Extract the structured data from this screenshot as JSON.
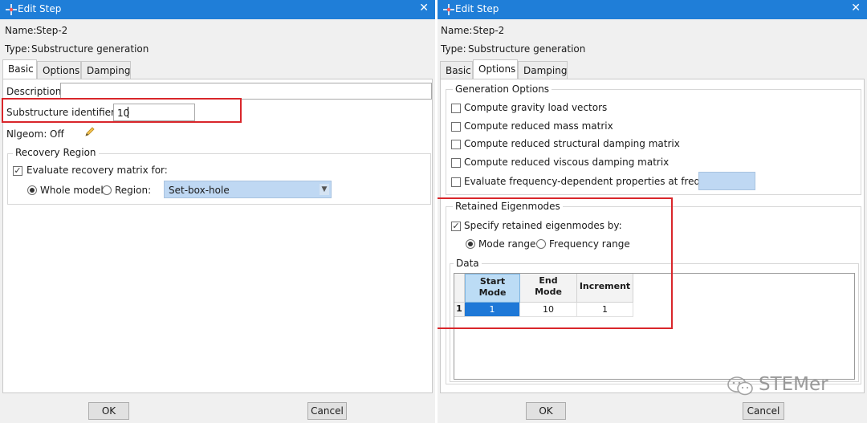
{
  "left": {
    "title": "Edit Step",
    "name_label": "Name:",
    "name_value": "Step-2",
    "type_label": "Type:",
    "type_value": "Substructure generation",
    "tabs": [
      "Basic",
      "Options",
      "Damping"
    ],
    "active_tab": "Basic",
    "description_label": "Description:",
    "description_value": "",
    "substructure_label": "Substructure identifier: Z",
    "substructure_value": "10",
    "nlgeom_label": "Nlgeom:",
    "nlgeom_value": "Off",
    "recovery_legend": "Recovery Region",
    "evaluate_label": "Evaluate recovery matrix for:",
    "evaluate_checked": true,
    "whole_model_label": "Whole model",
    "region_label": "Region:",
    "region_value": "Set-box-hole",
    "ok_label": "OK",
    "cancel_label": "Cancel"
  },
  "right": {
    "title": "Edit Step",
    "name_label": "Name:",
    "name_value": "Step-2",
    "type_label": "Type:",
    "type_value": "Substructure generation",
    "tabs": [
      "Basic",
      "Options",
      "Damping"
    ],
    "active_tab": "Options",
    "generation_legend": "Generation Options",
    "options": [
      "Compute gravity load vectors",
      "Compute reduced mass matrix",
      "Compute reduced structural damping matrix",
      "Compute reduced viscous damping matrix",
      "Evaluate frequency-dependent properties at frequency:"
    ],
    "retained_legend": "Retained Eigenmodes",
    "specify_label": "Specify retained eigenmodes by:",
    "specify_checked": true,
    "mode_range_label": "Mode range",
    "frequency_range_label": "Frequency range",
    "data_label": "Data",
    "table": {
      "headers": [
        "Start\nMode",
        "End\nMode",
        "Increment"
      ],
      "rows": [
        {
          "index": "1",
          "values": [
            "1",
            "10",
            "1"
          ]
        }
      ]
    },
    "ok_label": "OK",
    "cancel_label": "Cancel"
  },
  "watermark": "STEMer",
  "colors": {
    "titlebar": "#1f7ed8",
    "highlight_box": "#d9262b",
    "selection": "#1e78d7"
  }
}
